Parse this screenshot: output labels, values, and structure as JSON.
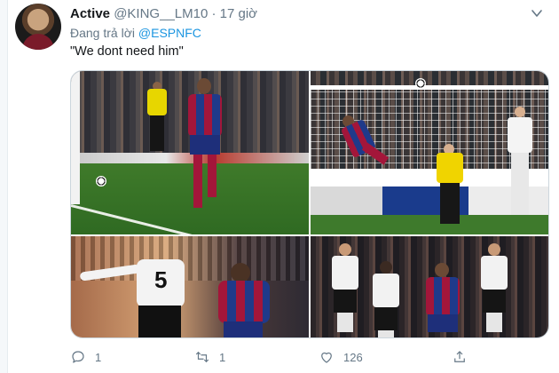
{
  "tweet": {
    "display_name": "Active",
    "handle": "@KING__LM10",
    "separator": "·",
    "time": "17 giờ",
    "reply_prefix": "Đang trả lời",
    "reply_to": "@ESPNFC",
    "text": "\"We dont need him\""
  },
  "media": {
    "photos": [
      {
        "name": "photo-messi-celebration"
      },
      {
        "name": "photo-messi-header-goal"
      },
      {
        "name": "photo-fabregas-vs-united"
      },
      {
        "name": "photo-barcelona-vs-united-players"
      }
    ]
  },
  "actions": {
    "reply_count": "1",
    "retweet_count": "1",
    "like_count": "126",
    "share_count": ""
  },
  "icons": {
    "reply": "speech-bubble-icon",
    "retweet": "retweet-arrows-icon",
    "like": "heart-icon",
    "share": "share-upload-icon",
    "more": "chevron-down-icon"
  },
  "colors": {
    "text_primary": "#14171a",
    "text_secondary": "#657786",
    "link": "#1b95e0",
    "border": "#ccd6dd"
  }
}
